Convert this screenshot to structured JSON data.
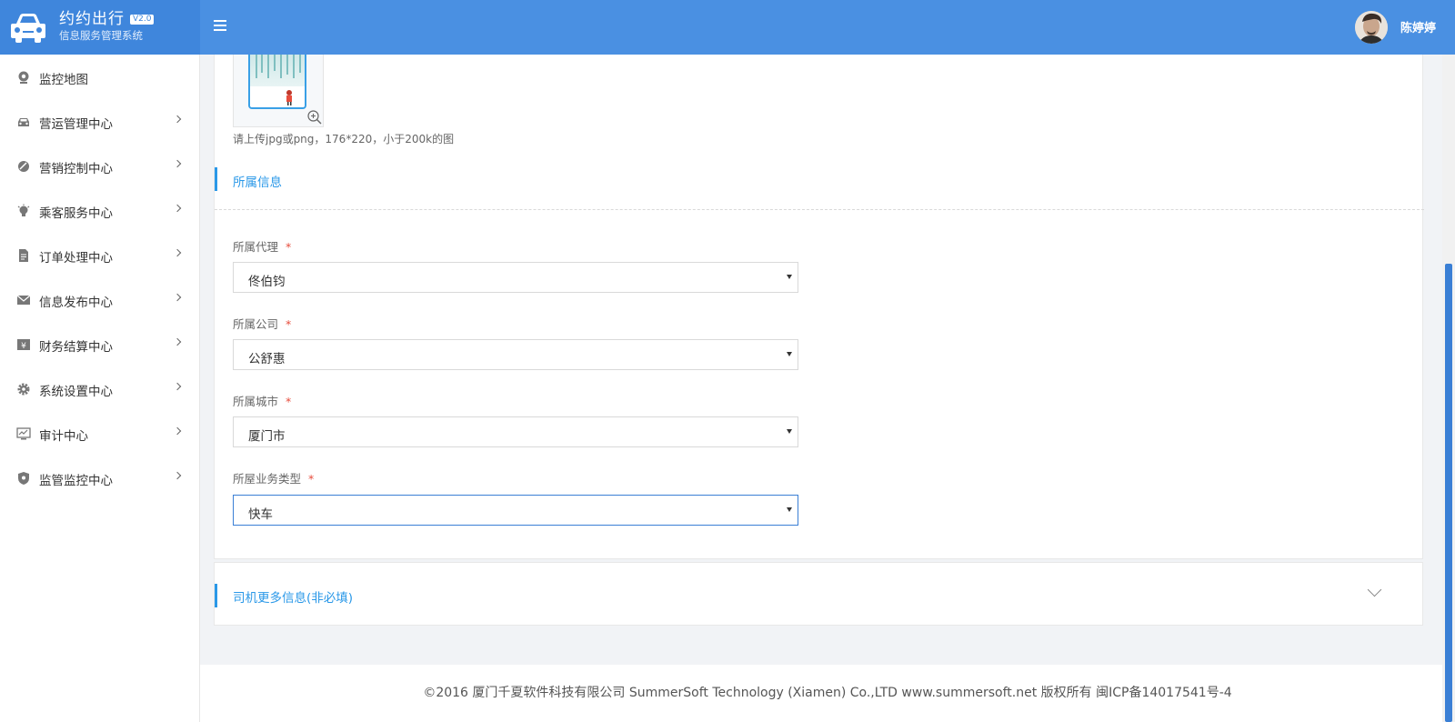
{
  "header": {
    "app_name": "约约出行",
    "version": "V2.0",
    "subtitle": "信息服务管理系统",
    "user_name": "陈婷婷"
  },
  "sidebar": {
    "items": [
      {
        "label": "监控地图",
        "icon": "monitor-map-icon",
        "has_children": false
      },
      {
        "label": "营运管理中心",
        "icon": "car-icon",
        "has_children": true
      },
      {
        "label": "营销控制中心",
        "icon": "tag-icon",
        "has_children": true
      },
      {
        "label": "乘客服务中心",
        "icon": "lightbulb-icon",
        "has_children": true
      },
      {
        "label": "订单处理中心",
        "icon": "document-icon",
        "has_children": true
      },
      {
        "label": "信息发布中心",
        "icon": "envelope-icon",
        "has_children": true
      },
      {
        "label": "财务结算中心",
        "icon": "finance-icon",
        "has_children": true
      },
      {
        "label": "系统设置中心",
        "icon": "gear-icon",
        "has_children": true
      },
      {
        "label": "审计中心",
        "icon": "chart-monitor-icon",
        "has_children": true
      },
      {
        "label": "监管监控中心",
        "icon": "shield-icon",
        "has_children": true
      }
    ]
  },
  "form": {
    "upload_hint": "请上传jpg或png，176*220，小于200k的图",
    "section_affiliation": "所属信息",
    "fields": [
      {
        "label": "所属代理",
        "required_mark": "*",
        "value": "佟伯钧"
      },
      {
        "label": "所属公司",
        "required_mark": "*",
        "value": "公舒惠"
      },
      {
        "label": "所属城市",
        "required_mark": "*",
        "value": "厦门市"
      },
      {
        "label": "所屋业务类型",
        "required_mark": "*",
        "value": "快车"
      }
    ],
    "more_info_title": "司机更多信息(非必填)"
  },
  "footer": {
    "copyright": "©2016 厦门千夏软件科技有限公司 SummerSoft Technology (Xiamen) Co.,LTD www.summersoft.net 版权所有 闽ICP备14017541号-4"
  },
  "colors": {
    "header_bg": "#4a90e2",
    "accent": "#2a98e8",
    "required": "#e74c3c"
  }
}
